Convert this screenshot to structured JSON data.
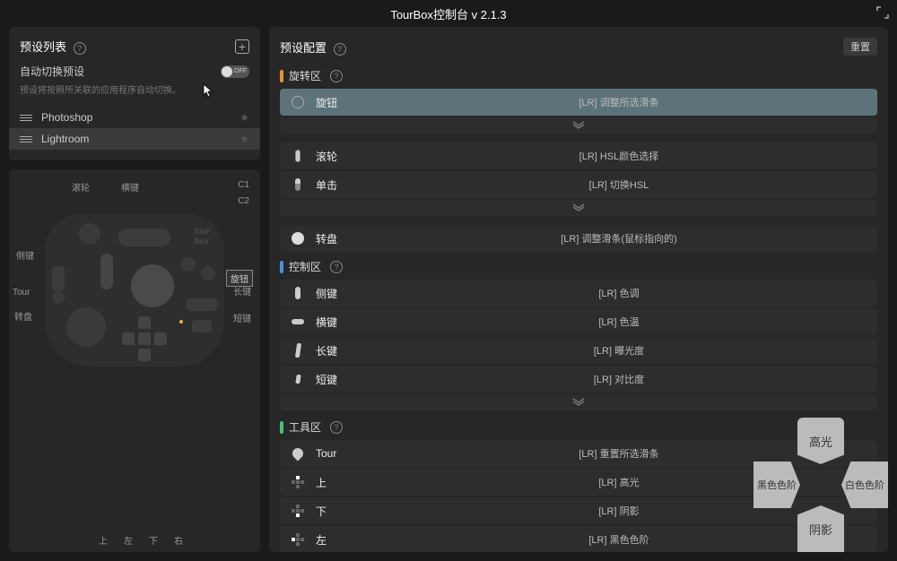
{
  "title": "TourBox控制台 v 2.1.3",
  "left": {
    "preset_list_title": "预设列表",
    "auto_switch_label": "自动切换预设",
    "auto_switch_state": "OFF",
    "auto_switch_hint": "预设将按照所关联的应用程序自动切换。",
    "presets": [
      {
        "name": "Photoshop"
      },
      {
        "name": "Lightroom"
      }
    ]
  },
  "device": {
    "labels": {
      "scroll": "滚轮",
      "hkey": "横键",
      "c1": "C1",
      "c2": "C2",
      "side": "侧键",
      "tour": "Tour",
      "dial": "转盘",
      "long": "长键",
      "short": "短键",
      "up": "上",
      "down": "下",
      "left": "左",
      "right": "右",
      "knob": "旋钮"
    }
  },
  "right": {
    "title": "预设配置",
    "reset": "重置",
    "sections": [
      {
        "marker": "orange",
        "name": "旋转区",
        "rows": [
          {
            "icon": "circ",
            "name": "旋钮",
            "value": "[LR] 调整所选滑条",
            "highlight": true
          },
          {
            "expand": true
          },
          {
            "icon": "wheel",
            "name": "滚轮",
            "value": "[LR] HSL颜色选择"
          },
          {
            "icon": "click",
            "name": "单击",
            "value": "[LR] 切换HSL"
          },
          {
            "expand": true
          },
          {
            "icon": "disc",
            "name": "转盘",
            "value": "[LR] 调整滑条(鼠标指向的)"
          }
        ]
      },
      {
        "marker": "blue",
        "name": "控制区",
        "rows": [
          {
            "icon": "bar-v",
            "name": "侧键",
            "value": "[LR] 色调"
          },
          {
            "icon": "bar-h",
            "name": "横键",
            "value": "[LR] 色温"
          },
          {
            "icon": "bar-l",
            "name": "长键",
            "value": "[LR] 曝光度"
          },
          {
            "icon": "bar-s",
            "name": "短键",
            "value": "[LR] 对比度"
          },
          {
            "expand": true
          }
        ]
      },
      {
        "marker": "green",
        "name": "工具区",
        "rows": [
          {
            "icon": "drop",
            "name": "Tour",
            "value": "[LR] 重置所选滑条"
          },
          {
            "icon": "dpad-u",
            "name": "上",
            "value": "[LR] 高光"
          },
          {
            "icon": "dpad-d",
            "name": "下",
            "value": "[LR] 阴影"
          },
          {
            "icon": "dpad-l",
            "name": "左",
            "value": "[LR] 黑色色阶"
          }
        ]
      }
    ]
  },
  "overlay": {
    "up": "高光",
    "down": "阴影",
    "left": "黑色色阶",
    "right": "白色色阶"
  }
}
